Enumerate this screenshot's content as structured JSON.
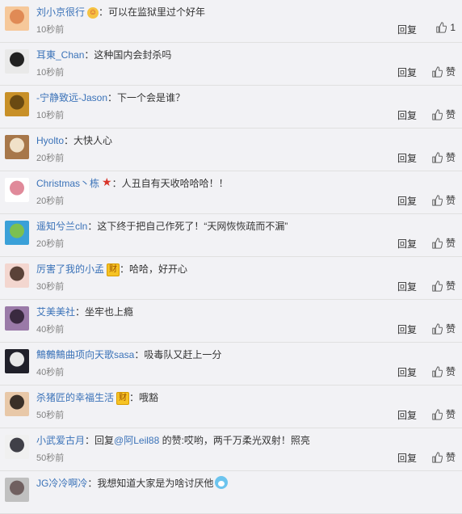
{
  "reply_label": "回复",
  "comments": [
    {
      "user": "刘小京很行",
      "badge": "emoji",
      "pre": "",
      "text": "可以在监狱里过个好年",
      "mention": "",
      "post": "",
      "time": "10秒前",
      "like": "1",
      "avatar": [
        "#f6c89a",
        "#e08a55"
      ]
    },
    {
      "user": "耳東_Chan",
      "badge": "",
      "pre": "",
      "text": "这种国内会封杀吗",
      "mention": "",
      "post": "",
      "time": "10秒前",
      "like": "赞",
      "avatar": [
        "#e9e9e9",
        "#222222"
      ]
    },
    {
      "user": "-宁静致远-Jason",
      "badge": "",
      "pre": "",
      "text": "下一个会是谁？",
      "mention": "",
      "post": "",
      "time": "10秒前",
      "like": "赞",
      "avatar": [
        "#c89028",
        "#6a4a12"
      ]
    },
    {
      "user": "Hyolto",
      "badge": "",
      "pre": "",
      "text": "大快人心",
      "mention": "",
      "post": "",
      "time": "20秒前",
      "like": "赞",
      "avatar": [
        "#a7774a",
        "#f0e1c8"
      ]
    },
    {
      "user": "Christmas丶栋",
      "badge": "star",
      "pre": "",
      "text": "人丑自有天收哈哈哈！！",
      "mention": "",
      "post": "",
      "time": "20秒前",
      "like": "赞",
      "avatar": [
        "#ffffff",
        "#e08a9a"
      ]
    },
    {
      "user": "遥知兮兰cln",
      "badge": "",
      "pre": "",
      "text": "这下终于把自己作死了！“天网恢恢疏而不漏”",
      "mention": "",
      "post": "",
      "time": "20秒前",
      "like": "赞",
      "avatar": [
        "#3aa0d8",
        "#7cc050"
      ]
    },
    {
      "user": "厉害了我的小孟",
      "badge": "cai",
      "pre": "",
      "text": "哈哈，好开心",
      "mention": "",
      "post": "",
      "time": "30秒前",
      "like": "赞",
      "avatar": [
        "#f3d6cf",
        "#5a4238"
      ]
    },
    {
      "user": "艾美美社",
      "badge": "",
      "pre": "",
      "text": "坐牢也上瘾",
      "mention": "",
      "post": "",
      "time": "40秒前",
      "like": "赞",
      "avatar": [
        "#9a7aa8",
        "#3a2a40"
      ]
    },
    {
      "user": "鷦鷯鷦曲项向天歌sasa",
      "badge": "",
      "pre": "",
      "text": "吸毒队又赶上一分",
      "mention": "",
      "post": "",
      "time": "40秒前",
      "like": "赞",
      "avatar": [
        "#20202a",
        "#e8e8e8"
      ]
    },
    {
      "user": "杀猪匠的幸福生活",
      "badge": "cai",
      "pre": "",
      "text": "哦豁",
      "mention": "",
      "post": "",
      "time": "50秒前",
      "like": "赞",
      "avatar": [
        "#e8c8a8",
        "#3a3028"
      ]
    },
    {
      "user": "小武爱古月",
      "badge": "",
      "pre": "回复",
      "text": "",
      "mention": "@阿Leil88",
      "post": " 的赞:哎哟，两千万柔光双射！照亮",
      "time": "50秒前",
      "like": "赞",
      "avatar": [
        "#f0f0f0",
        "#404048"
      ]
    },
    {
      "user": "JG冷冷啊冷",
      "badge": "",
      "pre": "",
      "text": "我想知道大家是为啥讨厌他",
      "mention": "",
      "post": "",
      "time": "",
      "like": "",
      "avatar": [
        "#c0c0c0",
        "#706060"
      ]
    }
  ]
}
